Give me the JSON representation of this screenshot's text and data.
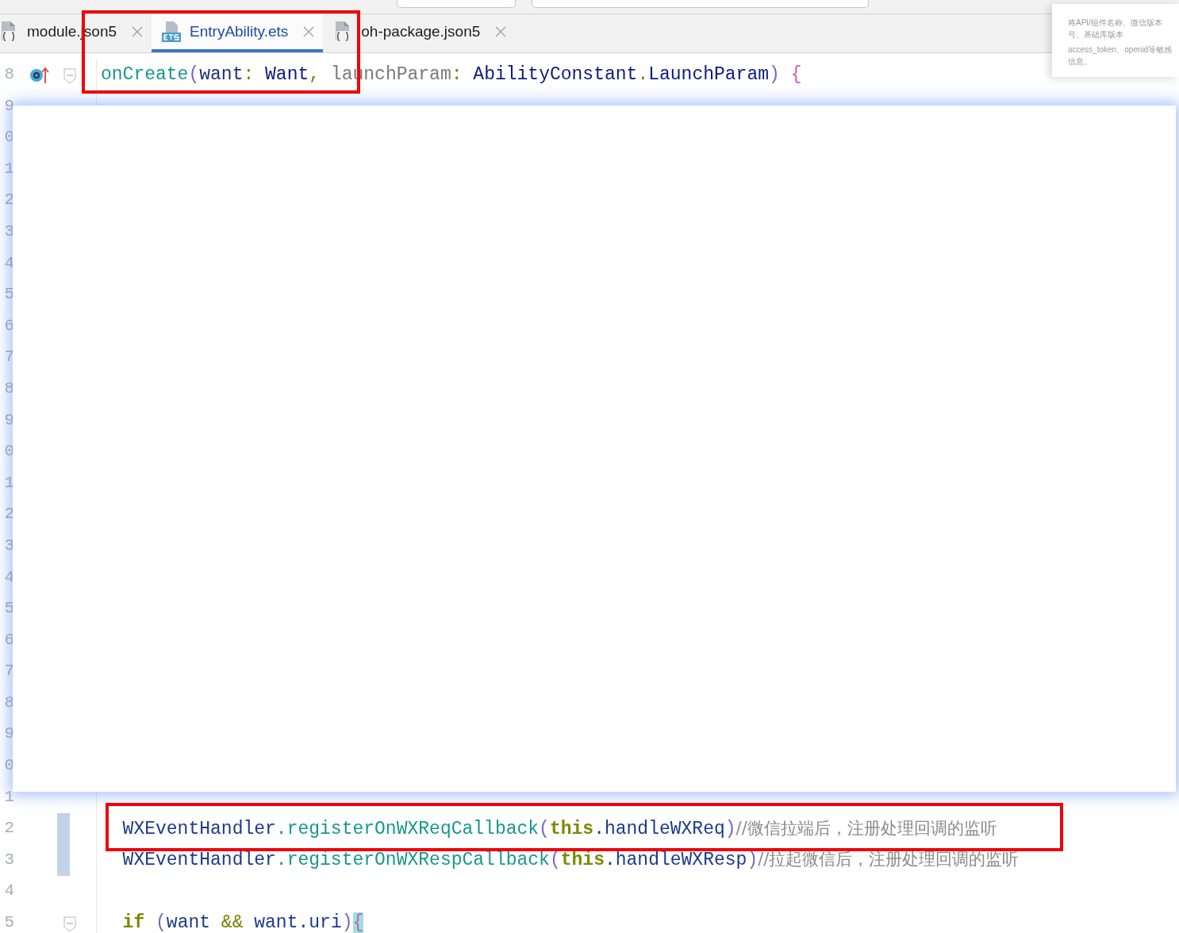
{
  "tabs": [
    {
      "label": "module.json5",
      "kind": "json",
      "selected": false
    },
    {
      "label": "EntryAbility.ets",
      "kind": "ets",
      "selected": true
    },
    {
      "label": "oh-package.json5",
      "kind": "json",
      "selected": false
    }
  ],
  "popup": {
    "lines": [
      "将API/组件名称、微信版本号、基础库版本",
      "access_token、openid等敏感信息。"
    ]
  },
  "lines": [
    {
      "number": "8",
      "override": true,
      "foldable": true,
      "changed": false,
      "tokens": [
        {
          "text": "onCreate",
          "kind": "method"
        },
        {
          "text": "(",
          "kind": "paren"
        },
        {
          "text": "want",
          "kind": "param"
        },
        {
          "text": ": ",
          "kind": "punct"
        },
        {
          "text": "Want",
          "kind": "type"
        },
        {
          "text": ", ",
          "kind": "punct"
        },
        {
          "text": "launchParam",
          "kind": "unused"
        },
        {
          "text": ": ",
          "kind": "punct"
        },
        {
          "text": "AbilityConstant",
          "kind": "type"
        },
        {
          "text": ".",
          "kind": "punct"
        },
        {
          "text": "LaunchParam",
          "kind": "type"
        },
        {
          "text": ") ",
          "kind": "paren"
        },
        {
          "text": "{",
          "kind": "brace"
        }
      ]
    },
    {
      "number": "9"
    },
    {
      "number": "0"
    },
    {
      "number": "1"
    },
    {
      "number": "2"
    },
    {
      "number": "3"
    },
    {
      "number": "4"
    },
    {
      "number": "5"
    },
    {
      "number": "6"
    },
    {
      "number": "7"
    },
    {
      "number": "8"
    },
    {
      "number": "9"
    },
    {
      "number": "0"
    },
    {
      "number": "1"
    },
    {
      "number": "2"
    },
    {
      "number": "3"
    },
    {
      "number": "4"
    },
    {
      "number": "5"
    },
    {
      "number": "6"
    },
    {
      "number": "7"
    },
    {
      "number": "8"
    },
    {
      "number": "9"
    },
    {
      "number": "0"
    },
    {
      "number": "1",
      "override": false,
      "foldable": false,
      "changed": false
    },
    {
      "number": "2",
      "override": false,
      "foldable": false,
      "changed": true,
      "tokens": [
        {
          "text": "  WXEventHandler",
          "kind": "field"
        },
        {
          "text": ".registerOnWXReqCallback",
          "kind": "method"
        },
        {
          "text": "(",
          "kind": "paren"
        },
        {
          "text": "this",
          "kind": "keyword"
        },
        {
          "text": ".handleWXReq",
          "kind": "field"
        },
        {
          "text": ")",
          "kind": "paren"
        },
        {
          "text": "//微信拉端后，注册处理回调的监听",
          "kind": "comment"
        }
      ]
    },
    {
      "number": "3",
      "override": false,
      "foldable": false,
      "changed": true,
      "tokens": [
        {
          "text": "  WXEventHandler",
          "kind": "field"
        },
        {
          "text": ".registerOnWXRespCallback",
          "kind": "method"
        },
        {
          "text": "(",
          "kind": "paren"
        },
        {
          "text": "this",
          "kind": "keyword"
        },
        {
          "text": ".handleWXResp",
          "kind": "field"
        },
        {
          "text": ")",
          "kind": "paren"
        },
        {
          "text": "//拉起微信后，注册处理回调的监听",
          "kind": "comment"
        }
      ]
    },
    {
      "number": "4",
      "override": false,
      "foldable": false,
      "changed": false
    },
    {
      "number": "5",
      "override": false,
      "foldable": true,
      "changed": false,
      "tokens": [
        {
          "text": "  if",
          "kind": "keyword"
        },
        {
          "text": " (",
          "kind": "paren"
        },
        {
          "text": "want",
          "kind": "field"
        },
        {
          "text": " && ",
          "kind": "punct"
        },
        {
          "text": "want",
          "kind": "field"
        },
        {
          "text": ".uri",
          "kind": "field"
        },
        {
          "text": ")",
          "kind": "paren"
        },
        {
          "text": "{",
          "kind": "brace",
          "matched": true
        }
      ]
    }
  ]
}
